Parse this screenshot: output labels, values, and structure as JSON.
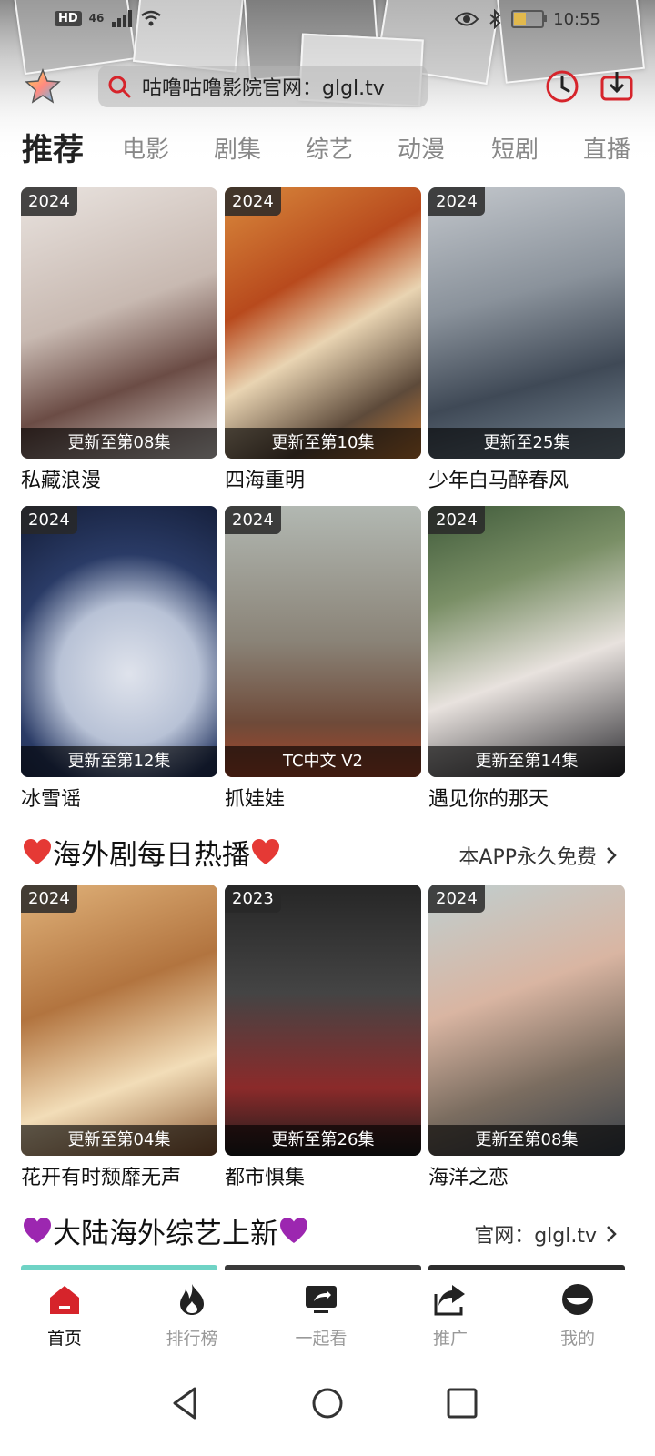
{
  "status_bar": {
    "hd_badge": "HD",
    "network": "46",
    "time": "10:55",
    "battery_percent": 40
  },
  "top_bar": {
    "search_placeholder": "咕噜咕噜影院官网：glgl.tv",
    "icons": [
      "favorites-star-icon",
      "search-icon",
      "history-clock-icon",
      "download-icon"
    ]
  },
  "tabs": [
    "推荐",
    "电影",
    "剧集",
    "综艺",
    "动漫",
    "短剧",
    "直播"
  ],
  "active_tab": 0,
  "recommended": [
    {
      "year": "2024",
      "episode": "更新至第08集",
      "title": "私藏浪漫"
    },
    {
      "year": "2024",
      "episode": "更新至第10集",
      "title": "四海重明"
    },
    {
      "year": "2024",
      "episode": "更新至25集",
      "title": "少年白马醉春风"
    },
    {
      "year": "2024",
      "episode": "更新至第12集",
      "title": "冰雪谣"
    },
    {
      "year": "2024",
      "episode": "TC中文 V2",
      "title": "抓娃娃"
    },
    {
      "year": "2024",
      "episode": "更新至第14集",
      "title": "遇见你的那天"
    }
  ],
  "section_overseas": {
    "title": "海外剧每日热播",
    "link": "本APP永久免费",
    "items": [
      {
        "year": "2024",
        "episode": "更新至第04集",
        "title": "花开有时颓靡无声"
      },
      {
        "year": "2023",
        "episode": "更新至第26集",
        "title": "都市惧集"
      },
      {
        "year": "2024",
        "episode": "更新至第08集",
        "title": "海洋之恋"
      }
    ]
  },
  "section_variety": {
    "title": "大陆海外综艺上新",
    "link": "官网：glgl.tv"
  },
  "bottom_nav": [
    {
      "label": "首页",
      "icon": "home-icon",
      "active": true
    },
    {
      "label": "排行榜",
      "icon": "flame-icon",
      "active": false
    },
    {
      "label": "一起看",
      "icon": "watch-together-icon",
      "active": false
    },
    {
      "label": "推广",
      "icon": "share-icon",
      "active": false
    },
    {
      "label": "我的",
      "icon": "profile-icon",
      "active": false
    }
  ],
  "colors": {
    "accent": "#d6242b",
    "heart_red": "#e53935",
    "heart_purple": "#9c27b0",
    "tab_inactive": "#888888"
  }
}
